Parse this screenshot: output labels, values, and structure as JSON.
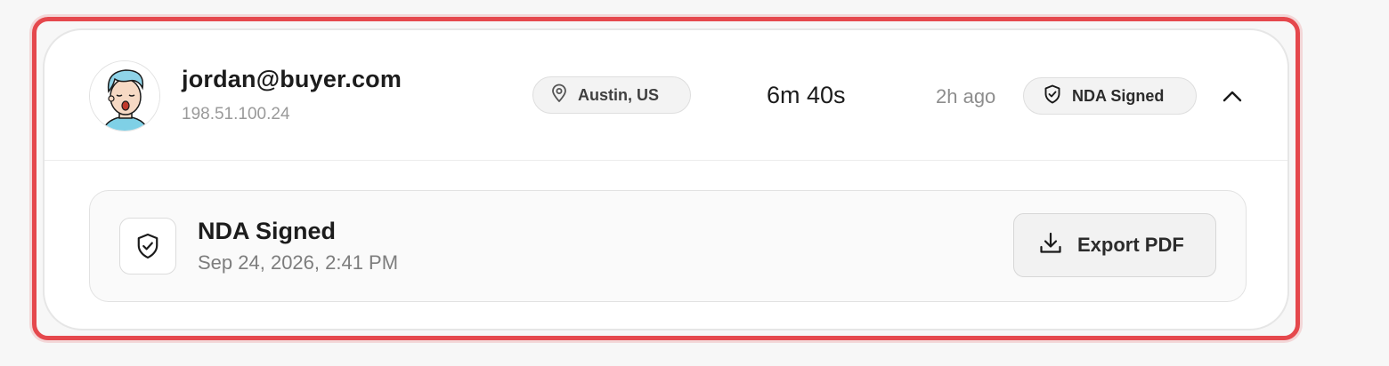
{
  "session": {
    "email": "jordan@buyer.com",
    "ip": "198.51.100.24",
    "location": "Austin, US",
    "duration": "6m 40s",
    "time_ago": "2h ago",
    "nda_badge": "NDA Signed"
  },
  "details": {
    "title": "NDA Signed",
    "date": "Sep 24, 2026, 2:41 PM",
    "export_label": "Export PDF"
  },
  "icons": {
    "location": "map-pin-icon",
    "nda": "shield-check-icon",
    "collapse": "chevron-up-icon",
    "export": "download-icon"
  },
  "colors": {
    "highlight": "#e5484d",
    "avatar_hair": "#8fd3e8",
    "avatar_shirt": "#7fd0e6"
  }
}
